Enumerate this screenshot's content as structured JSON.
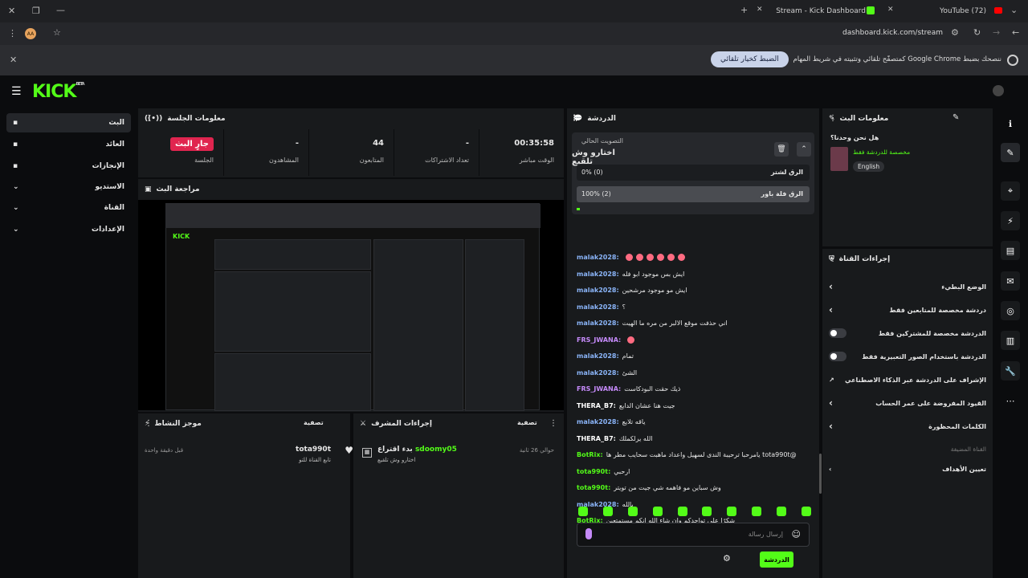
{
  "browser": {
    "tab_active": "Stream - Kick Dashboard",
    "tab_other": "(72) YouTube",
    "url": "dashboard.kick.com/stream",
    "profile_initials": "AA",
    "infobar_text": "ننصحك بضبط Google Chrome كمتصفّح تلقائي وتثبيته في شريط المهام",
    "infobar_button": "الضبط كخيار تلقائي"
  },
  "app": {
    "logo": "KICK",
    "logo_badge": "BETA"
  },
  "sidebar": {
    "items": [
      {
        "label": "البث",
        "icon": "stream-icon",
        "active": true
      },
      {
        "label": "العائد",
        "icon": "revenue-icon"
      },
      {
        "label": "الإنجازات",
        "icon": "trophy-icon"
      },
      {
        "label": "الاستديو",
        "icon": "studio-icon"
      },
      {
        "label": "القناة",
        "icon": "channel-icon"
      },
      {
        "label": "الإعدادات",
        "icon": "settings-icon"
      }
    ]
  },
  "session": {
    "title": "معلومات الجلسة",
    "live_badge": "جارٍ البث",
    "live_label": "الجلسة",
    "stats": [
      {
        "value": "00:35:58",
        "label": "الوقت مباشر"
      },
      {
        "value": "-",
        "label": "تعداد الاشتراكات"
      },
      {
        "value": "44",
        "label": "المتابعون"
      },
      {
        "value": "-",
        "label": "المشاهدون"
      }
    ]
  },
  "preview": {
    "title": "مراجعة البث"
  },
  "activity": {
    "title": "موجز النشاط",
    "filter": "تصفية",
    "item_user": "tota990t",
    "item_text": "تابع القناة للتو",
    "item_time": "قبل دقيقة واحدة"
  },
  "mod_actions": {
    "title": "إجراءات المشرف",
    "filter": "تصفية",
    "item_user": "sdoomy05",
    "item_action": "بدء اقتراع",
    "item_text": "اختارو وش تلقيع",
    "item_time": "حوالي 26 ثانية"
  },
  "chat": {
    "title": "الدردشة",
    "poll": {
      "label": "التصويت الحالي",
      "question": "اختارو وش تلقيع",
      "options": [
        {
          "text": "الرق لشتر",
          "result": "0% (0)",
          "percent": 0
        },
        {
          "text": "الرق فلة باور",
          "result": "100% (2)",
          "percent": 100
        }
      ]
    },
    "messages": [
      {
        "user": "malak2028:",
        "text": "",
        "color": "#8ab4f8",
        "emojis": 6
      },
      {
        "user": "malak2028:",
        "text": "ايش بس موجود ابو فله",
        "color": "#8ab4f8"
      },
      {
        "user": "malak2028:",
        "text": "ايش مو موجود مرشحين",
        "color": "#8ab4f8"
      },
      {
        "user": "malak2028:",
        "text": "؟",
        "color": "#8ab4f8"
      },
      {
        "user": "malak2028:",
        "text": "اني حذفت موقع الالبر من مره ما الهيت",
        "color": "#8ab4f8"
      },
      {
        "user": "FRS_JWANA:",
        "text": "",
        "color": "#c58af9",
        "emojis": 1
      },
      {
        "user": "malak2028:",
        "text": "تمام",
        "color": "#8ab4f8"
      },
      {
        "user": "malak2028:",
        "text": "الشئ",
        "color": "#8ab4f8"
      },
      {
        "user": "FRS_JWANA:",
        "text": "ذيك حقت البودكاست",
        "color": "#c58af9"
      },
      {
        "user": "THERA_B7:",
        "text": "جيت هنا عشان الدايع",
        "color": "#ffffff"
      },
      {
        "user": "malak2028:",
        "text": "ياقه تلايع",
        "color": "#8ab4f8"
      },
      {
        "user": "THERA_B7:",
        "text": "الله يرلكملك",
        "color": "#ffffff"
      },
      {
        "user": "BotRix:",
        "text": "@tota990t يامرحبا ترحيبة الندى لسهيل واعداد ماهبت سحايب مطر ها",
        "color": "#53fc18"
      },
      {
        "user": "tota990t:",
        "text": "ارحبي",
        "color": "#53fc18"
      },
      {
        "user": "tota990t:",
        "text": "وش سباين مو فاهمه شي جيت من تويتر",
        "color": "#53fc18"
      },
      {
        "user": "malak2028:",
        "text": "يالله",
        "color": "#8ab4f8"
      },
      {
        "user": "BotRix:",
        "text": "شكرًا على تواجدكم وان شاء الله انكم مستمتعين",
        "color": "#53fc18"
      }
    ],
    "input_placeholder": "إرسال رسالة",
    "send_label": "الدردشة"
  },
  "stream_info": {
    "title": "معلومات البث",
    "stream_title": "هل نحن وحدنا؟",
    "stream_category": "مخصصة للدردشة فقط",
    "language": "English"
  },
  "channel_actions": {
    "title": "إجراءات القناة",
    "items": [
      {
        "label": "الوضع البطيء",
        "kind": "chevron"
      },
      {
        "label": "دردشة مخصصة للمتابعين فقط",
        "kind": "chevron"
      },
      {
        "label": "الدردشة مخصصة للمشتركين فقط",
        "kind": "toggle"
      },
      {
        "label": "الدردشة باستخدام الصور التعبيرية فقط",
        "kind": "toggle"
      },
      {
        "label": "الإشراف على الدردشة عبر الذكاء الاصطناعي",
        "kind": "external"
      },
      {
        "label": "القيود المفروضة على عمر الحساب",
        "kind": "chevron"
      },
      {
        "label": "الكلمات المحظورة",
        "kind": "chevron"
      }
    ],
    "section_label": "القناة المضيفة",
    "goals_label": "تعيين الأهداف"
  },
  "colors": {
    "brand": "#53fc18",
    "live": "#e0254f"
  }
}
